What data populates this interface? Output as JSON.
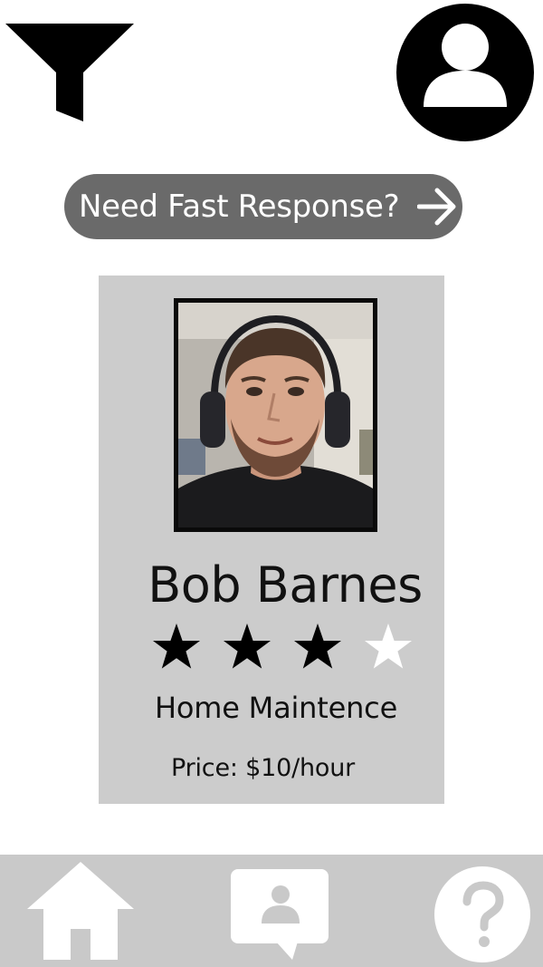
{
  "header": {
    "filter_icon": "filter-funnel-icon",
    "profile_icon": "user-profile-icon"
  },
  "fast_response": {
    "label": "Need Fast Response?",
    "icon": "arrow-right-icon"
  },
  "provider_card": {
    "name": "Bob Barnes",
    "rating": 3,
    "rating_max": 4,
    "service": "Home Maintence",
    "price": "Price: $10/hour"
  },
  "bottom_nav": {
    "items": [
      {
        "id": "home",
        "icon": "home-icon"
      },
      {
        "id": "contacts",
        "icon": "contact-chat-icon"
      },
      {
        "id": "help",
        "icon": "help-question-icon"
      }
    ]
  },
  "colors": {
    "background": "#ffffff",
    "card_background": "#cccccc",
    "button_background": "#6a6a6a",
    "nav_background": "#c9c9c9",
    "icon_dark": "#000000",
    "star_filled": "#000000",
    "star_empty": "#ffffff"
  }
}
